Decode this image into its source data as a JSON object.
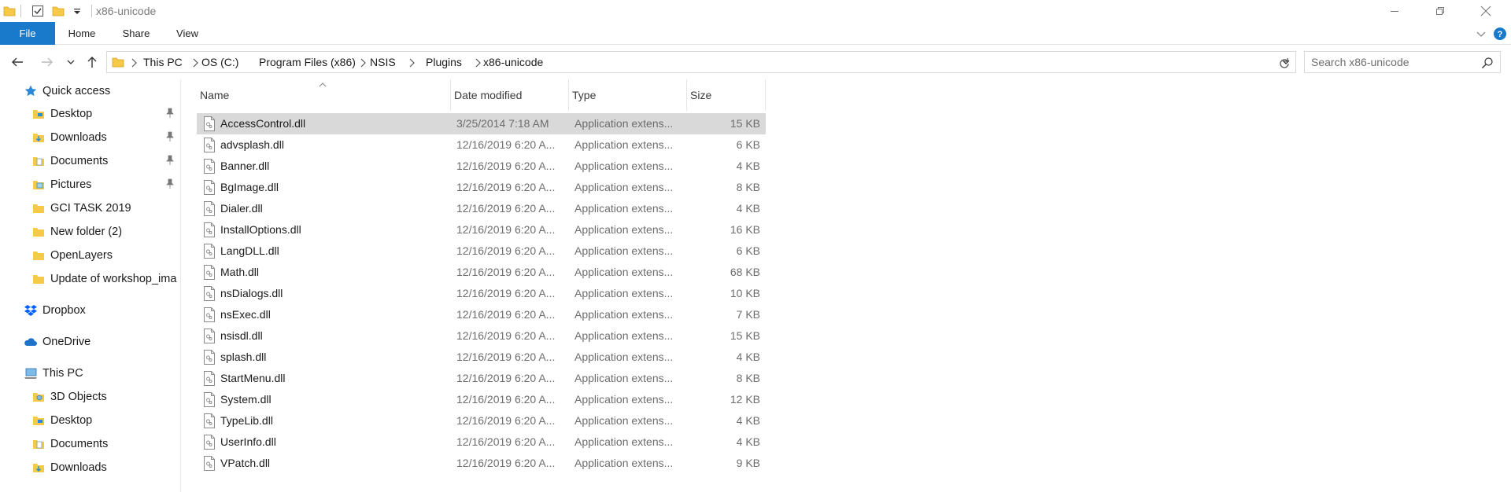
{
  "window": {
    "title": "x86-unicode"
  },
  "ribbon": {
    "tabs": [
      {
        "label": "File"
      },
      {
        "label": "Home"
      },
      {
        "label": "Share"
      },
      {
        "label": "View"
      }
    ],
    "accent": "#1979ca"
  },
  "address": {
    "crumbs": [
      "This PC",
      "OS (C:)",
      "Program Files (x86)",
      "NSIS",
      "Plugins",
      "x86-unicode"
    ]
  },
  "search": {
    "placeholder": "Search x86-unicode"
  },
  "sidebar": {
    "items": [
      {
        "label": "Quick access",
        "icon": "star-icon"
      },
      {
        "label": "Desktop",
        "icon": "desktop-folder-icon",
        "pinned": true
      },
      {
        "label": "Downloads",
        "icon": "downloads-folder-icon",
        "pinned": true
      },
      {
        "label": "Documents",
        "icon": "documents-folder-icon",
        "pinned": true
      },
      {
        "label": "Pictures",
        "icon": "pictures-folder-icon",
        "pinned": true
      },
      {
        "label": "GCI TASK 2019",
        "icon": "folder-icon"
      },
      {
        "label": "New folder (2)",
        "icon": "folder-icon"
      },
      {
        "label": "OpenLayers",
        "icon": "folder-icon"
      },
      {
        "label": "Update of workshop_ima",
        "icon": "folder-icon"
      },
      {
        "label": "Dropbox",
        "icon": "dropbox-icon"
      },
      {
        "label": "OneDrive",
        "icon": "cloud-icon"
      },
      {
        "label": "This PC",
        "icon": "computer-icon"
      },
      {
        "label": "3D Objects",
        "icon": "3d-objects-folder-icon"
      },
      {
        "label": "Desktop",
        "icon": "desktop-folder-icon"
      },
      {
        "label": "Documents",
        "icon": "documents-folder-icon"
      },
      {
        "label": "Downloads",
        "icon": "downloads-folder-icon"
      }
    ]
  },
  "columns": {
    "name": "Name",
    "date": "Date modified",
    "type": "Type",
    "size": "Size"
  },
  "files": [
    {
      "name": "AccessControl.dll",
      "date": "3/25/2014 7:18 AM",
      "type": "Application extens...",
      "size": "15 KB",
      "selected": true
    },
    {
      "name": "advsplash.dll",
      "date": "12/16/2019 6:20 A...",
      "type": "Application extens...",
      "size": "6 KB"
    },
    {
      "name": "Banner.dll",
      "date": "12/16/2019 6:20 A...",
      "type": "Application extens...",
      "size": "4 KB"
    },
    {
      "name": "BgImage.dll",
      "date": "12/16/2019 6:20 A...",
      "type": "Application extens...",
      "size": "8 KB"
    },
    {
      "name": "Dialer.dll",
      "date": "12/16/2019 6:20 A...",
      "type": "Application extens...",
      "size": "4 KB"
    },
    {
      "name": "InstallOptions.dll",
      "date": "12/16/2019 6:20 A...",
      "type": "Application extens...",
      "size": "16 KB"
    },
    {
      "name": "LangDLL.dll",
      "date": "12/16/2019 6:20 A...",
      "type": "Application extens...",
      "size": "6 KB"
    },
    {
      "name": "Math.dll",
      "date": "12/16/2019 6:20 A...",
      "type": "Application extens...",
      "size": "68 KB"
    },
    {
      "name": "nsDialogs.dll",
      "date": "12/16/2019 6:20 A...",
      "type": "Application extens...",
      "size": "10 KB"
    },
    {
      "name": "nsExec.dll",
      "date": "12/16/2019 6:20 A...",
      "type": "Application extens...",
      "size": "7 KB"
    },
    {
      "name": "nsisdl.dll",
      "date": "12/16/2019 6:20 A...",
      "type": "Application extens...",
      "size": "15 KB"
    },
    {
      "name": "splash.dll",
      "date": "12/16/2019 6:20 A...",
      "type": "Application extens...",
      "size": "4 KB"
    },
    {
      "name": "StartMenu.dll",
      "date": "12/16/2019 6:20 A...",
      "type": "Application extens...",
      "size": "8 KB"
    },
    {
      "name": "System.dll",
      "date": "12/16/2019 6:20 A...",
      "type": "Application extens...",
      "size": "12 KB"
    },
    {
      "name": "TypeLib.dll",
      "date": "12/16/2019 6:20 A...",
      "type": "Application extens...",
      "size": "4 KB"
    },
    {
      "name": "UserInfo.dll",
      "date": "12/16/2019 6:20 A...",
      "type": "Application extens...",
      "size": "4 KB"
    },
    {
      "name": "VPatch.dll",
      "date": "12/16/2019 6:20 A...",
      "type": "Application extens...",
      "size": "9 KB"
    }
  ]
}
